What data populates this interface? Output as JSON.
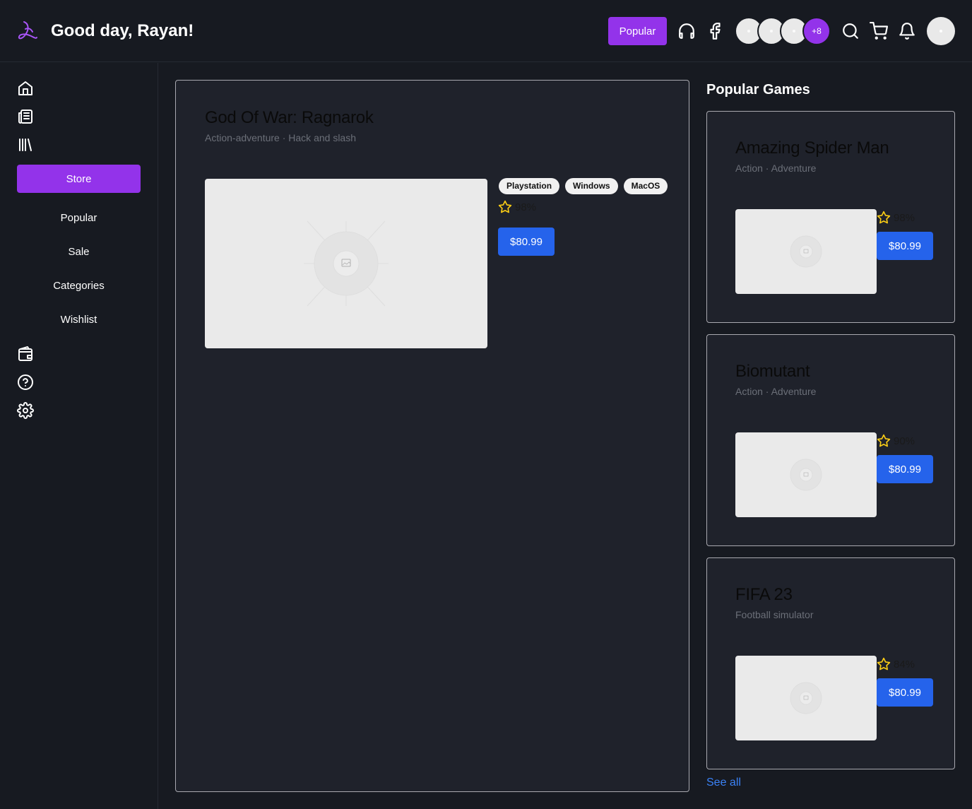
{
  "header": {
    "greeting": "Good day, Rayan!",
    "popular_label": "Popular",
    "avatars_more": "+8"
  },
  "sidebar": {
    "store_label": "Store",
    "nav": [
      "Popular",
      "Sale",
      "Categories",
      "Wishlist"
    ]
  },
  "featured": {
    "title": "God Of War: Ragnarok",
    "genre": "Action-adventure · Hack and slash",
    "platforms": [
      "Playstation",
      "Windows",
      "MacOS"
    ],
    "rating": "98%",
    "price": "$80.99"
  },
  "popular_games": {
    "heading": "Popular Games",
    "items": [
      {
        "title": "Amazing Spider Man",
        "genre": "Action · Adventure",
        "rating": "98%",
        "price": "$80.99"
      },
      {
        "title": "Biomutant",
        "genre": "Action · Adventure",
        "rating": "90%",
        "price": "$80.99"
      },
      {
        "title": "FIFA 23",
        "genre": "Football simulator",
        "rating": "84%",
        "price": "$80.99"
      }
    ],
    "see_all": "See all"
  },
  "colors": {
    "background": "#171a21",
    "accent": "#9333ea",
    "price_button": "#2563eb",
    "star": "#facc15",
    "link": "#3b82f6"
  }
}
